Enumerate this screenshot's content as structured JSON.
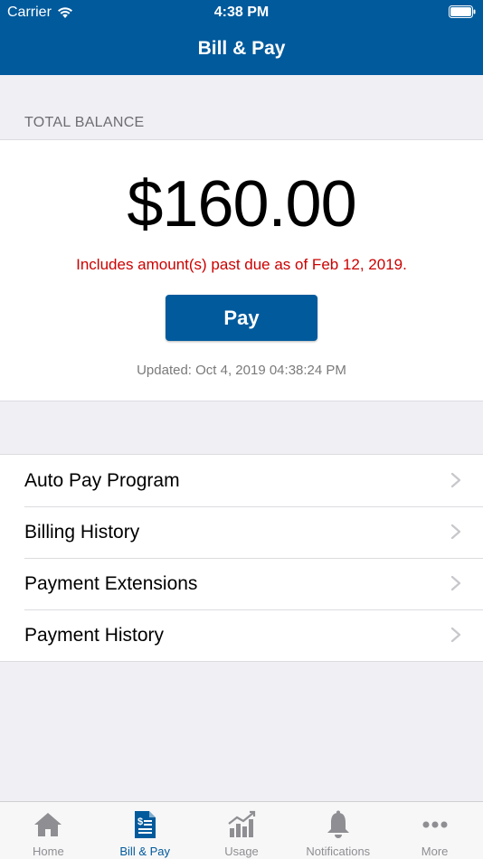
{
  "status_bar": {
    "carrier": "Carrier",
    "time": "4:38 PM"
  },
  "nav": {
    "title": "Bill & Pay"
  },
  "balance": {
    "section_label": "TOTAL BALANCE",
    "amount": "$160.00",
    "past_due_notice": "Includes amount(s) past due as of Feb 12, 2019.",
    "pay_label": "Pay",
    "updated_text": "Updated: Oct 4, 2019 04:38:24 PM"
  },
  "menu": {
    "items": [
      {
        "label": "Auto Pay Program"
      },
      {
        "label": "Billing History"
      },
      {
        "label": "Payment Extensions"
      },
      {
        "label": "Payment History"
      }
    ]
  },
  "tabbar": {
    "tabs": [
      {
        "label": "Home",
        "icon": "home-icon"
      },
      {
        "label": "Bill & Pay",
        "icon": "bill-icon",
        "active": true
      },
      {
        "label": "Usage",
        "icon": "usage-chart-icon"
      },
      {
        "label": "Notifications",
        "icon": "bell-icon"
      },
      {
        "label": "More",
        "icon": "ellipsis-icon"
      }
    ]
  },
  "colors": {
    "brand": "#005a9c",
    "past_due": "#cc0000",
    "tab_inactive": "#8e8e93"
  }
}
